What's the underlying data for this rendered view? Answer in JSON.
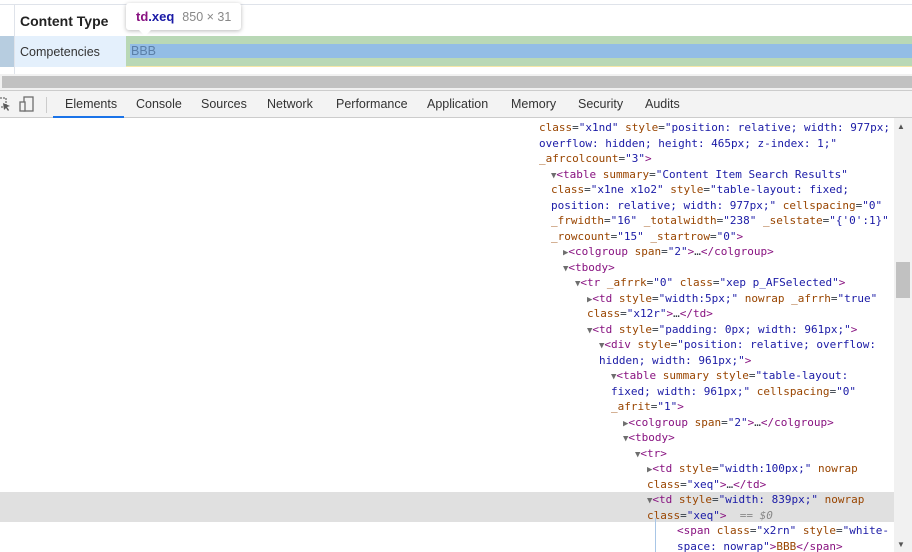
{
  "page": {
    "header_label": "Content Type",
    "row_label": "Competencies",
    "row_value": "BBB",
    "tooltip": {
      "tag": "td",
      "class": ".xeq",
      "dimensions": "850 × 31"
    }
  },
  "devtools": {
    "toolbar": {
      "inspect_icon": "inspect-element-icon",
      "device_icon": "device-toolbar-icon",
      "tabs": [
        {
          "label": "Elements",
          "active": true
        },
        {
          "label": "Console"
        },
        {
          "label": "Sources"
        },
        {
          "label": "Network"
        },
        {
          "label": "Performance"
        },
        {
          "label": "Application"
        },
        {
          "label": "Memory"
        },
        {
          "label": "Security"
        },
        {
          "label": "Audits"
        }
      ]
    },
    "dom_lines": [
      "class=\"x1nd\" style=\"position: relative; width: 977px;",
      "overflow: hidden; height: 465px; z-index: 1;\"",
      "_afrcolcount=\"3\">",
      "<table summary=\"Content Item Search Results\"",
      "class=\"x1ne x1o2\" style=\"table-layout: fixed;",
      "position: relative; width: 977px;\" cellspacing=\"0\"",
      "_frwidth=\"16\" _totalwidth=\"238\" _selstate=\"{'0':1}\"",
      "_rowcount=\"15\" _startrow=\"0\">",
      "<colgroup span=\"2\">…</colgroup>",
      "<tbody>",
      "<tr _afrrk=\"0\" class=\"xep p_AFSelected\">",
      "<td style=\"width:5px;\" nowrap _afrrh=\"true\"",
      "class=\"x12r\">…</td>",
      "<td style=\"padding: 0px; width: 961px;\">",
      "<div style=\"position: relative; overflow:",
      "hidden; width: 961px;\">",
      "<table summary style=\"table-layout:",
      "fixed; width: 961px;\" cellspacing=\"0\"",
      "_afrit=\"1\">",
      "<colgroup span=\"2\">…</colgroup>",
      "<tbody>",
      "<tr>",
      "<td style=\"width:100px;\" nowrap",
      "class=\"xeq\">…</td>",
      "<td style=\"width: 839px;\" nowrap",
      "class=\"xeq\"> == $0",
      "<span class=\"x2rn\" style=\"white-",
      "space: nowrap\">BBB</span>"
    ],
    "selected_marker": "== $0"
  }
}
